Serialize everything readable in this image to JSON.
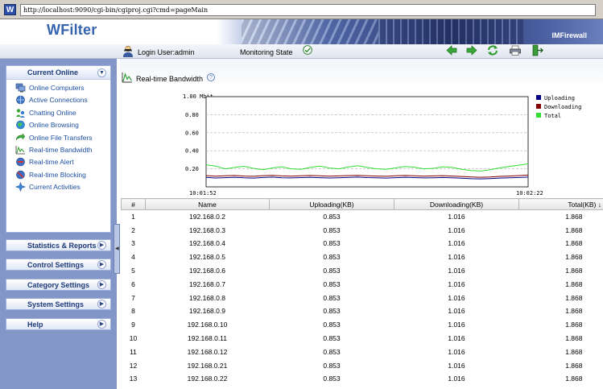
{
  "browser": {
    "url": "http://localhost:9090/cgi-bin/cgiproj.cgi?cmd=pageMain",
    "logo_text": "W"
  },
  "header": {
    "brand": "WFilter",
    "product": "IMFirewall"
  },
  "toolbar": {
    "login_text": "Login User:admin",
    "monitoring_text": "Monitoring State",
    "buttons": [
      "arrow-left-icon",
      "arrow-right-icon",
      "refresh-icon",
      "print-icon",
      "logout-icon"
    ]
  },
  "sidebar": {
    "current_online": {
      "title": "Current Online",
      "items": [
        {
          "label": "Online Computers",
          "icon": "computers-icon"
        },
        {
          "label": "Active Connections",
          "icon": "connections-icon"
        },
        {
          "label": "Chatting Online",
          "icon": "chat-icon"
        },
        {
          "label": "Online Browsing",
          "icon": "browsing-icon"
        },
        {
          "label": "Online File Transfers",
          "icon": "file-transfer-icon"
        },
        {
          "label": "Real-time Bandwidth",
          "icon": "bandwidth-icon"
        },
        {
          "label": "Real-time Alert",
          "icon": "alert-icon"
        },
        {
          "label": "Real-time Blocking",
          "icon": "blocking-icon"
        },
        {
          "label": "Current Activities",
          "icon": "activities-icon"
        }
      ]
    },
    "sections": [
      {
        "label": "Statistics & Reports"
      },
      {
        "label": "Control Settings"
      },
      {
        "label": "Category Settings"
      },
      {
        "label": "System Settings"
      },
      {
        "label": "Help"
      }
    ]
  },
  "page": {
    "title": "Real-time Bandwidth",
    "help_glyph": "?"
  },
  "chart_data": {
    "type": "line",
    "y_unit_label": "1.00 Mbit",
    "yticks": [
      "0.80",
      "0.60",
      "0.40",
      "0.20"
    ],
    "ylim": [
      0,
      1.0
    ],
    "x_start": "10:01:52",
    "x_end": "10:02:22",
    "legend_position": "top-right",
    "series": [
      {
        "name": "Uploading",
        "color": "#000080",
        "values": [
          0.105,
          0.098,
          0.102,
          0.106,
          0.1,
          0.097,
          0.104,
          0.108,
          0.101,
          0.099,
          0.103,
          0.106,
          0.102,
          0.098,
          0.101,
          0.105,
          0.108,
          0.103,
          0.1,
          0.097,
          0.102,
          0.106,
          0.103,
          0.099,
          0.101,
          0.104,
          0.1,
          0.096,
          0.09,
          0.088,
          0.092,
          0.097,
          0.1,
          0.104,
          0.108
        ]
      },
      {
        "name": "Downloading",
        "color": "#800000",
        "values": [
          0.125,
          0.118,
          0.122,
          0.126,
          0.12,
          0.117,
          0.124,
          0.128,
          0.121,
          0.119,
          0.123,
          0.126,
          0.122,
          0.118,
          0.121,
          0.125,
          0.128,
          0.123,
          0.12,
          0.117,
          0.122,
          0.126,
          0.123,
          0.119,
          0.121,
          0.124,
          0.12,
          0.115,
          0.11,
          0.106,
          0.11,
          0.116,
          0.12,
          0.125,
          0.13
        ]
      },
      {
        "name": "Total",
        "color": "#33dd33",
        "values": [
          0.245,
          0.23,
          0.2,
          0.215,
          0.228,
          0.205,
          0.19,
          0.21,
          0.222,
          0.2,
          0.195,
          0.215,
          0.23,
          0.21,
          0.2,
          0.22,
          0.235,
          0.215,
          0.2,
          0.195,
          0.21,
          0.225,
          0.218,
          0.2,
          0.205,
          0.222,
          0.215,
          0.195,
          0.18,
          0.175,
          0.19,
          0.21,
          0.225,
          0.24,
          0.255
        ]
      }
    ]
  },
  "table": {
    "columns": [
      "#",
      "Name",
      "Uploading(KB)",
      "Downloading(KB)",
      "Total(KB) ↓"
    ],
    "rows": [
      [
        "1",
        "192.168.0.2",
        "0.853",
        "1.016",
        "1.868"
      ],
      [
        "2",
        "192.168.0.3",
        "0.853",
        "1.016",
        "1.868"
      ],
      [
        "3",
        "192.168.0.4",
        "0.853",
        "1.016",
        "1.868"
      ],
      [
        "4",
        "192.168.0.5",
        "0.853",
        "1.016",
        "1.868"
      ],
      [
        "5",
        "192.168.0.6",
        "0.853",
        "1.016",
        "1.868"
      ],
      [
        "6",
        "192.168.0.7",
        "0.853",
        "1.016",
        "1.868"
      ],
      [
        "7",
        "192.168.0.8",
        "0.853",
        "1.016",
        "1.868"
      ],
      [
        "8",
        "192.168.0.9",
        "0.853",
        "1.016",
        "1.868"
      ],
      [
        "9",
        "192.168.0.10",
        "0.853",
        "1.016",
        "1.868"
      ],
      [
        "10",
        "192.168.0.11",
        "0.853",
        "1.016",
        "1.868"
      ],
      [
        "11",
        "192.168.0.12",
        "0.853",
        "1.016",
        "1.868"
      ],
      [
        "12",
        "192.168.0.21",
        "0.853",
        "1.016",
        "1.868"
      ],
      [
        "13",
        "192.168.0.22",
        "0.853",
        "1.016",
        "1.868"
      ]
    ]
  }
}
